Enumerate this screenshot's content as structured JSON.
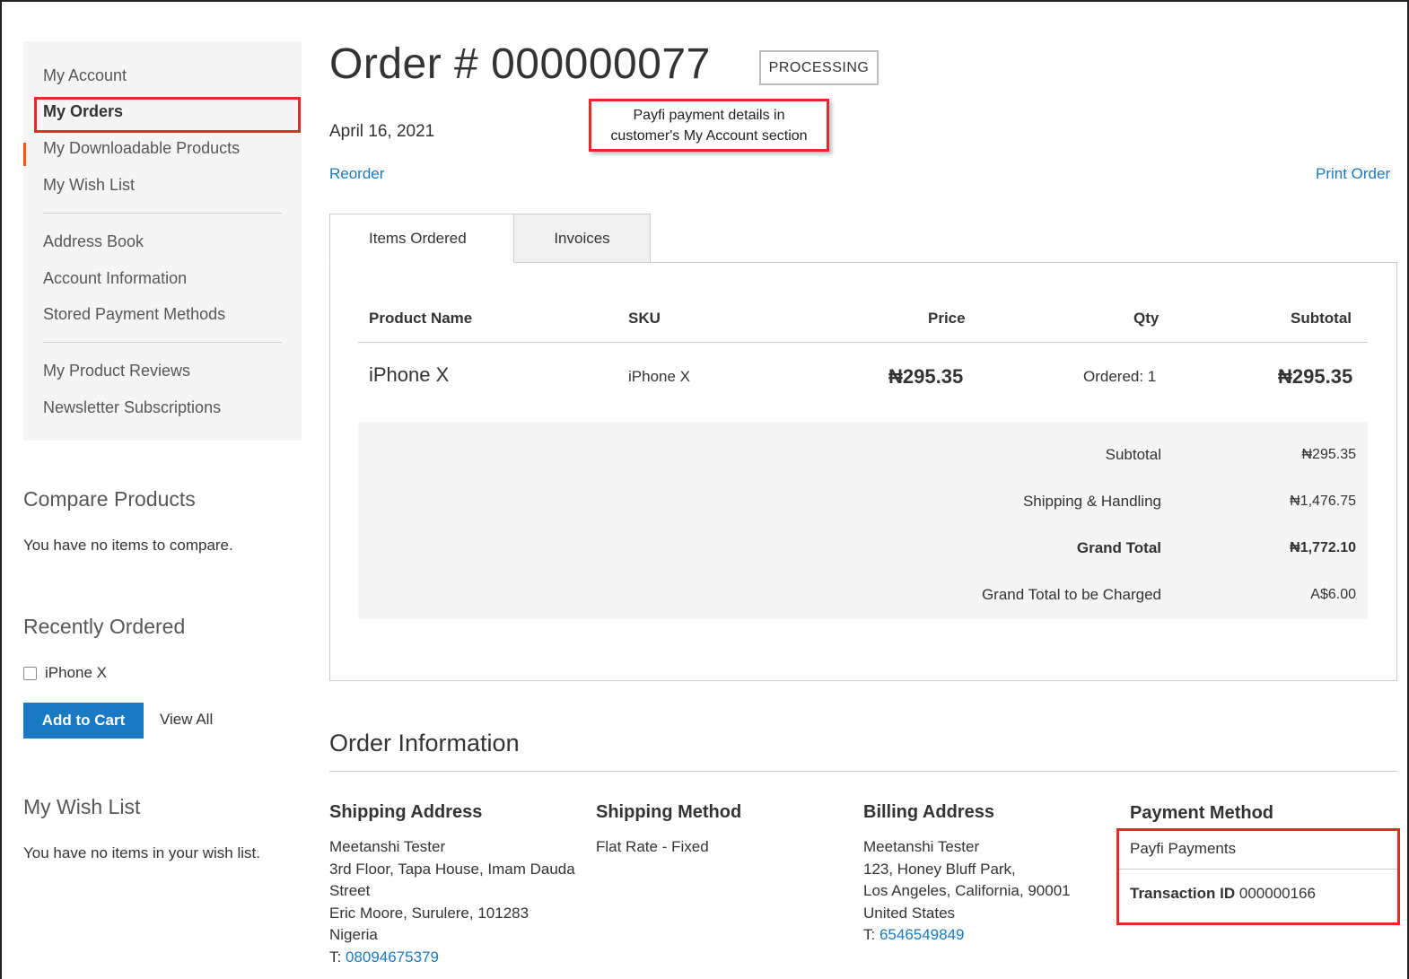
{
  "sidebar": {
    "nav_group1": [
      "My Account",
      "My Orders",
      "My Downloadable Products",
      "My Wish List"
    ],
    "nav_group2": [
      "Address Book",
      "Account Information",
      "Stored Payment Methods"
    ],
    "nav_group3": [
      "My Product Reviews",
      "Newsletter Subscriptions"
    ],
    "current_item": "My Orders",
    "compare": {
      "title": "Compare Products",
      "empty_text": "You have no items to compare."
    },
    "recently_ordered": {
      "title": "Recently Ordered",
      "item": "iPhone X",
      "add_to_cart": "Add to Cart",
      "view_all": "View All"
    },
    "wishlist": {
      "title": "My Wish List",
      "empty_text": "You have no items in your wish list."
    }
  },
  "order": {
    "title": "Order # 000000077",
    "status": "PROCESSING",
    "date": "April 16, 2021",
    "reorder": "Reorder",
    "print": "Print Order"
  },
  "callout": {
    "line1": "Payfi payment details in",
    "line2": "customer's My Account section"
  },
  "tabs": {
    "items_ordered": "Items Ordered",
    "invoices": "Invoices"
  },
  "items_table": {
    "headers": {
      "product": "Product Name",
      "sku": "SKU",
      "price": "Price",
      "qty": "Qty",
      "subtotal": "Subtotal"
    },
    "rows": [
      {
        "product": "iPhone X",
        "sku": "iPhone X",
        "price": "₦295.35",
        "qty": "Ordered: 1",
        "subtotal": "₦295.35"
      }
    ]
  },
  "totals": {
    "subtotal_label": "Subtotal",
    "subtotal_value": "₦295.35",
    "shipping_label": "Shipping & Handling",
    "shipping_value": "₦1,476.75",
    "grand_label": "Grand Total",
    "grand_value": "₦1,772.10",
    "charged_label": "Grand Total to be Charged",
    "charged_value": "A$6.00"
  },
  "order_info": {
    "title": "Order Information",
    "shipping_address": {
      "title": "Shipping Address",
      "lines": [
        "Meetanshi Tester",
        "3rd Floor, Tapa House, Imam Dauda",
        "Street",
        "Eric Moore, Surulere, 101283",
        "Nigeria"
      ],
      "phone_prefix": "T: ",
      "phone": "08094675379"
    },
    "shipping_method": {
      "title": "Shipping Method",
      "value": "Flat Rate - Fixed"
    },
    "billing_address": {
      "title": "Billing Address",
      "lines": [
        "Meetanshi Tester",
        "123, Honey Bluff Park,",
        "Los Angeles, California, 90001",
        "United States"
      ],
      "phone_prefix": "T: ",
      "phone": "6546549849"
    },
    "payment_method": {
      "title": "Payment Method",
      "name": "Payfi Payments",
      "txn_label": "Transaction ID",
      "txn_value": "000000166"
    }
  },
  "colors": {
    "link": "#1979c3",
    "button": "#1979c3",
    "highlight": "#e02b27",
    "nav_accent": "#ff5501"
  }
}
